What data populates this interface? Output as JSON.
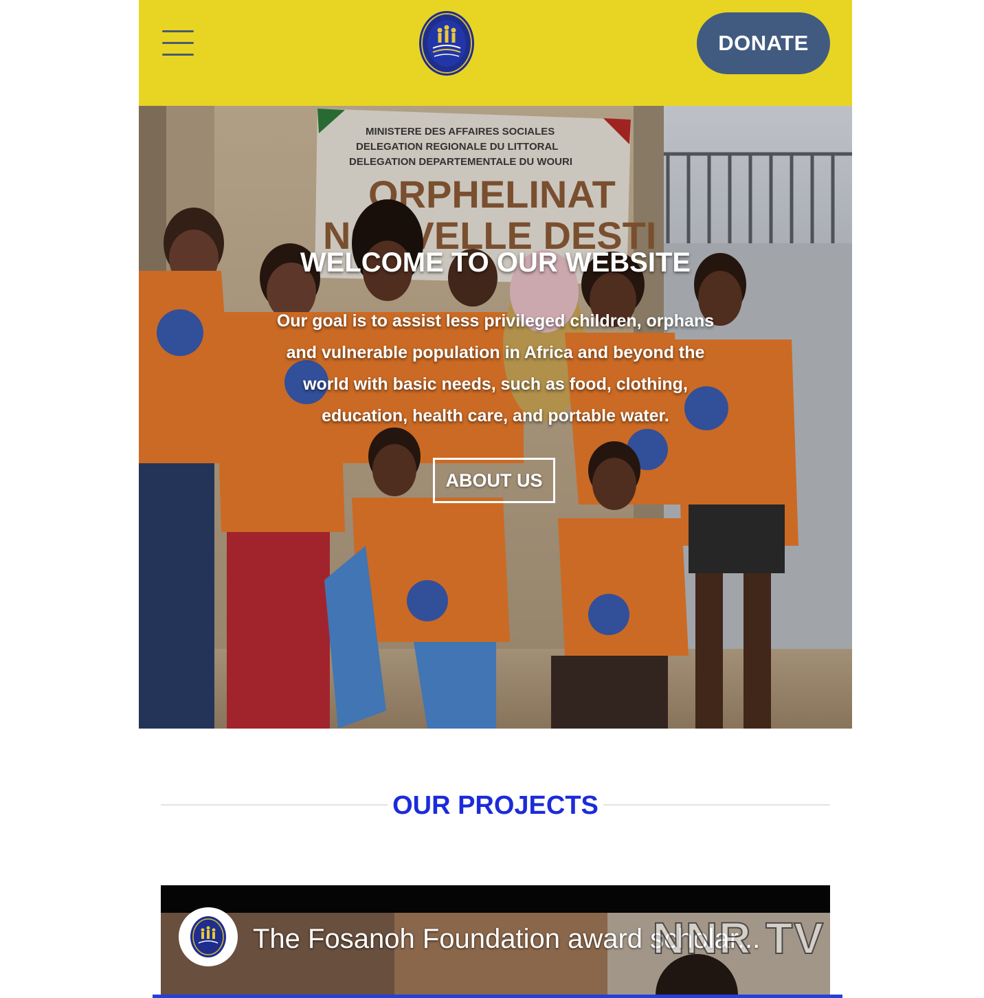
{
  "header": {
    "background_color": "#e8d523",
    "menu_icon": "hamburger-menu-icon",
    "logo_icon": "foundation-logo-icon",
    "donate_label": "DONATE",
    "donate_color": "#415b80"
  },
  "hero": {
    "title": "WELCOME TO OUR WEBSITE",
    "text": "Our goal is to assist less privileged children, orphans and vulnerable population in Africa and beyond the world with basic needs, such as food, clothing, education, health care, and portable water.",
    "button_label": "ABOUT US",
    "sign_lines": [
      "MINISTERE DES AFFAIRES SOCIALES",
      "DELEGATION REGIONALE DU LITTORAL",
      "DELEGATION DEPARTEMENTALE DU WOURI",
      "ORPHELINAT",
      "NOUVELLE DESTI"
    ]
  },
  "projects": {
    "heading": "OUR PROJECTS",
    "heading_color": "#1c2bd9"
  },
  "video": {
    "title": "The Fosanoh Foundation award scholar...",
    "watermark": "NNR TV",
    "avatar_icon": "channel-avatar-icon"
  },
  "colors": {
    "accent_blue": "#2440d8",
    "tshirt_orange": "#e8792a"
  }
}
